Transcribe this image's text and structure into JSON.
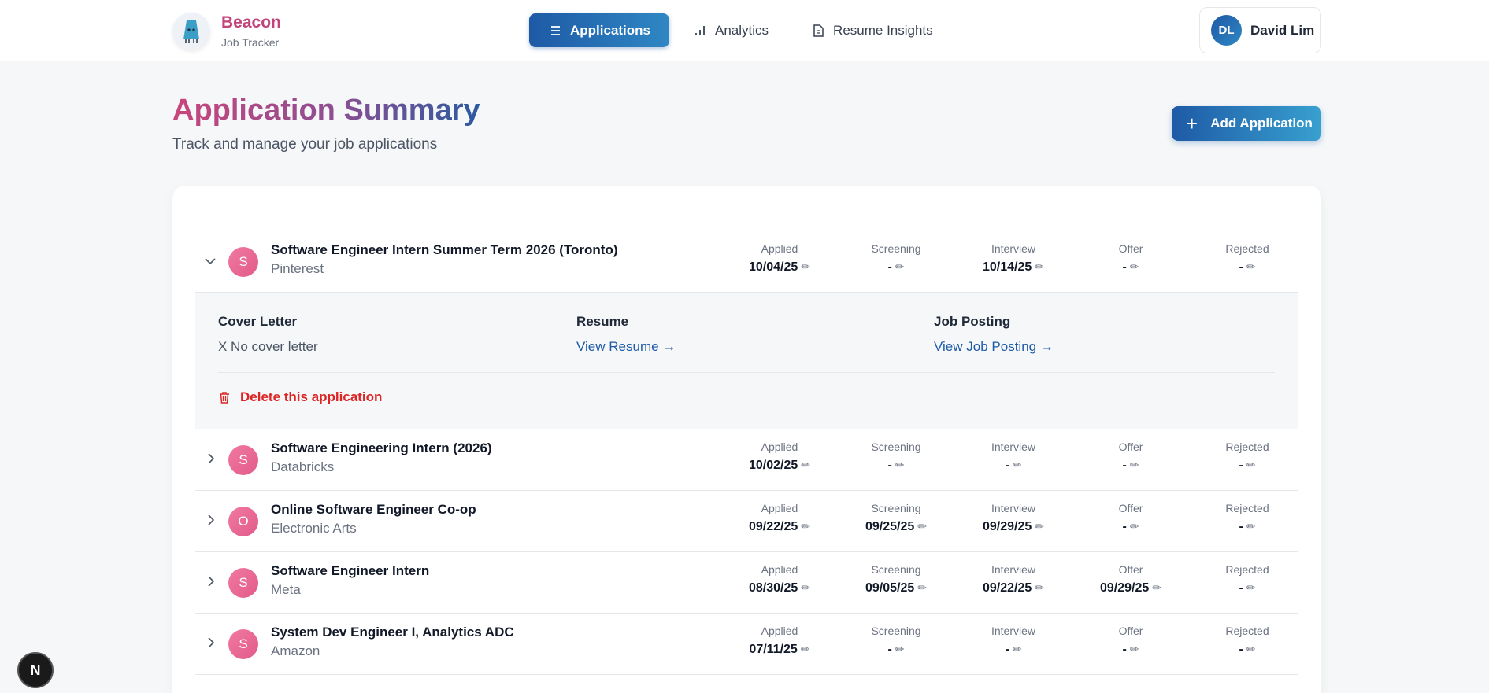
{
  "brand": {
    "name": "Beacon",
    "subtitle": "Job Tracker"
  },
  "nav": [
    {
      "label": "Applications",
      "icon": "list-icon",
      "active": true
    },
    {
      "label": "Analytics",
      "icon": "bar-chart-icon",
      "active": false
    },
    {
      "label": "Resume Insights",
      "icon": "document-icon",
      "active": false
    }
  ],
  "user": {
    "initials": "DL",
    "name": "David Lim"
  },
  "page": {
    "title": "Application Summary",
    "subtitle": "Track and manage your job applications",
    "add_label": "Add Application"
  },
  "stage_labels": [
    "Applied",
    "Screening",
    "Interview",
    "Offer",
    "Rejected"
  ],
  "applications": [
    {
      "initial": "S",
      "title": "Software Engineer Intern Summer Term 2026 (Toronto)",
      "company": "Pinterest",
      "expanded": true,
      "dates": [
        "10/04/25",
        "-",
        "10/14/25",
        "-",
        "-"
      ]
    },
    {
      "initial": "S",
      "title": "Software Engineering Intern (2026)",
      "company": "Databricks",
      "expanded": false,
      "dates": [
        "10/02/25",
        "-",
        "-",
        "-",
        "-"
      ]
    },
    {
      "initial": "O",
      "title": "Online Software Engineer Co-op",
      "company": "Electronic Arts",
      "expanded": false,
      "dates": [
        "09/22/25",
        "09/25/25",
        "09/29/25",
        "-",
        "-"
      ]
    },
    {
      "initial": "S",
      "title": "Software Engineer Intern",
      "company": "Meta",
      "expanded": false,
      "dates": [
        "08/30/25",
        "09/05/25",
        "09/22/25",
        "09/29/25",
        "-"
      ]
    },
    {
      "initial": "S",
      "title": "System Dev Engineer I, Analytics ADC",
      "company": "Amazon",
      "expanded": false,
      "dates": [
        "07/11/25",
        "-",
        "-",
        "-",
        "-"
      ]
    }
  ],
  "details": {
    "cover_letter_label": "Cover Letter",
    "cover_letter_value": "X No cover letter",
    "resume_label": "Resume",
    "resume_link": "View Resume →",
    "job_posting_label": "Job Posting",
    "job_posting_link": "View Job Posting →",
    "delete_label": "Delete this application"
  },
  "badge": {
    "letter": "N"
  },
  "colors": {
    "accent": "#1e5aa6",
    "brand": "#c2447a",
    "danger": "#dc2626",
    "avatar": "#e25a8a"
  }
}
